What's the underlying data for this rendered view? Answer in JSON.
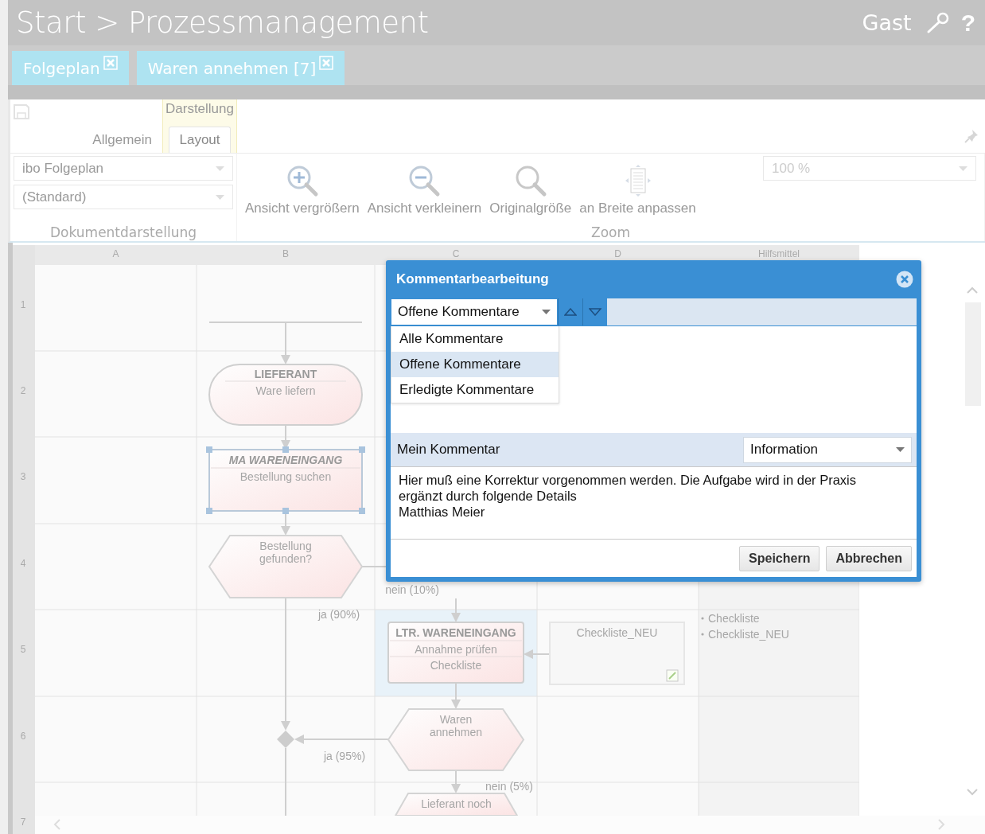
{
  "header": {
    "breadcrumb": "Start > Prozessmanagement",
    "user": "Gast",
    "help": "?"
  },
  "doc_tabs": [
    {
      "label": "Folgeplan"
    },
    {
      "label": "Waren annehmen [7]"
    }
  ],
  "ribbon": {
    "context_label": "Darstellung",
    "tabs": [
      {
        "label": "Allgemein",
        "selected": false
      },
      {
        "label": "Layout",
        "selected": true
      }
    ],
    "document_group": {
      "label": "Dokumentdarstellung",
      "dropdowns": [
        "ibo Folgeplan",
        "(Standard)"
      ]
    },
    "zoom_group": {
      "label": "Zoom",
      "buttons": [
        {
          "label": "Ansicht vergrößern",
          "kind": "zoom-in"
        },
        {
          "label": "Ansicht verkleinern",
          "kind": "zoom-out"
        },
        {
          "label": "Originalgröße",
          "kind": "original"
        },
        {
          "label": "an Breite anpassen",
          "kind": "fit-width"
        }
      ],
      "zoom_value": "100 %"
    }
  },
  "diagram": {
    "columns": [
      "A",
      "B",
      "C",
      "D",
      "Hilfsmittel"
    ],
    "rows": [
      "1",
      "2",
      "3",
      "4",
      "5",
      "6",
      "7"
    ],
    "nodes": [
      {
        "kind": "terminal",
        "title": "LIEFERANT",
        "lines": [
          "Ware liefern"
        ],
        "selected": false,
        "italic": false
      },
      {
        "kind": "process",
        "title": "MA WARENEINGANG",
        "lines": [
          "Bestellung suchen"
        ],
        "selected": true,
        "italic": true
      },
      {
        "kind": "decision",
        "lines": [
          "Bestellung",
          "gefunden?"
        ]
      },
      {
        "kind": "process",
        "title": "LTR. WARENEINGANG",
        "lines": [
          "Annahme prüfen",
          "Checkliste"
        ],
        "selected": false,
        "italic": false
      },
      {
        "kind": "document",
        "lines": [
          "Checkliste_NEU"
        ]
      },
      {
        "kind": "decision",
        "lines": [
          "Waren",
          "annehmen"
        ]
      },
      {
        "kind": "decision",
        "lines": [
          "Lieferant noch"
        ]
      }
    ],
    "flow_labels": [
      "nein (10%)",
      "ja (90%)",
      "ja (95%)",
      "nein (5%)"
    ],
    "resources": [
      "Checkliste",
      "Checkliste_NEU"
    ]
  },
  "dialog": {
    "title": "Kommentarbearbeitung",
    "filter": "Offene Kommentare",
    "filter_options": [
      {
        "label": "Alle Kommentare",
        "selected": false
      },
      {
        "label": "Offene Kommentare",
        "selected": true
      },
      {
        "label": "Erledigte Kommentare",
        "selected": false
      }
    ],
    "comment_label": "Mein Kommentar",
    "comment_type": "Information",
    "comment_lines": [
      "Hier muß eine Korrektur vorgenommen werden. Die Aufgabe wird in der Praxis",
      "ergänzt durch folgende Details",
      "Matthias Meier"
    ],
    "buttons": [
      "Speichern",
      "Abbrechen"
    ]
  }
}
